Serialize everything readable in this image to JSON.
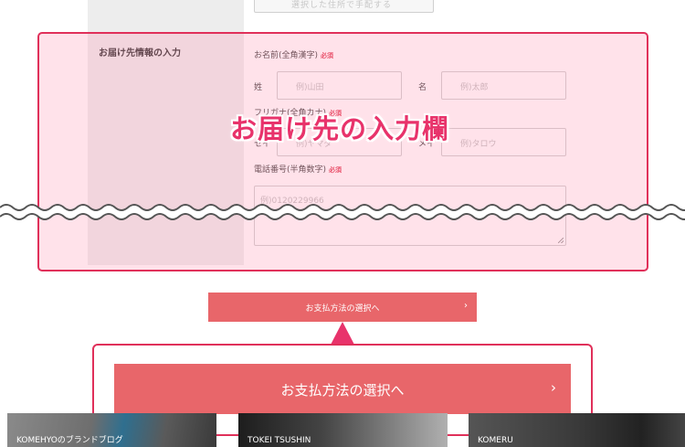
{
  "top_section": {
    "button_label": "選択した住所で手配する"
  },
  "form": {
    "section_label": "お届け先情報の入力",
    "name_label": "お名前(全角漢字)",
    "required": "必須",
    "last_name_prefix": "姓",
    "last_name_placeholder": "例)山田",
    "first_name_prefix": "名",
    "first_name_placeholder": "例)太郎",
    "kana_label": "フリガナ(全角カナ)",
    "kana_last_prefix": "セイ",
    "kana_last_placeholder": "例)ヤマダ",
    "kana_first_prefix": "メイ",
    "kana_first_placeholder": "例)タロウ",
    "phone_label": "電話番号(半角数字)",
    "phone_placeholder": "例)0120229966"
  },
  "annotation": {
    "caption": "お届け先の入力欄"
  },
  "proceed": {
    "label": "お支払方法の選択へ",
    "chevron": "›"
  },
  "banners": [
    {
      "caption": "KOMEHYOのブランドブログ"
    },
    {
      "caption": "TOKEI TSUSHIN"
    },
    {
      "caption": "KOMERU"
    }
  ],
  "colors": {
    "accent": "#e8336b",
    "button": "#e8666a",
    "overlay_border": "#e0305a"
  }
}
